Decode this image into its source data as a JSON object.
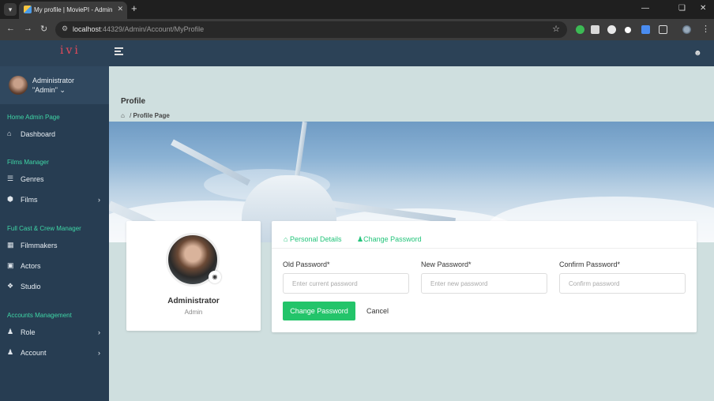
{
  "browser": {
    "tab_title": "My profile | MoviePI - Admin",
    "url_host": "localhost",
    "url_path": ":44329/Admin/Account/MyProfile",
    "extension_badge": "2"
  },
  "header": {
    "logo_text": "ivi"
  },
  "sidebar": {
    "user": {
      "name": "Administrator",
      "role": "\"Admin\""
    },
    "sections": [
      {
        "title": "Home Admin Page",
        "items": [
          {
            "label": "Dashboard",
            "icon": "home-icon"
          }
        ]
      },
      {
        "title": "Films Manager",
        "items": [
          {
            "label": "Genres",
            "icon": "list-icon"
          },
          {
            "label": "Films",
            "icon": "cube-icon",
            "has_submenu": true
          }
        ]
      },
      {
        "title": "Full Cast & Crew Manager",
        "items": [
          {
            "label": "Filmmakers",
            "icon": "film-icon"
          },
          {
            "label": "Actors",
            "icon": "id-card-icon"
          },
          {
            "label": "Studio",
            "icon": "dropbox-icon"
          }
        ]
      },
      {
        "title": "Accounts Management",
        "items": [
          {
            "label": "Role",
            "icon": "user-gear-icon",
            "has_submenu": true
          },
          {
            "label": "Account",
            "icon": "user-gear-icon",
            "has_submenu": true
          }
        ]
      }
    ]
  },
  "main": {
    "page_title": "Profile",
    "breadcrumb": {
      "current": "Profile Page"
    },
    "profile_card": {
      "name": "Administrator",
      "role": "Admin"
    },
    "tabs": [
      {
        "label": "Personal Details",
        "icon": "home-icon"
      },
      {
        "label": "Change Password",
        "icon": "user-icon"
      }
    ],
    "form": {
      "old_password": {
        "label": "Old Password*",
        "placeholder": "Enter current password"
      },
      "new_password": {
        "label": "New Password*",
        "placeholder": "Enter new password"
      },
      "confirm_password": {
        "label": "Confirm Password*",
        "placeholder": "Confirm password"
      },
      "submit_label": "Change Password",
      "cancel_label": "Cancel"
    }
  },
  "colors": {
    "sidebar_bg": "#273d52",
    "header_bg": "#2c4257",
    "section_title": "#3fd6a6",
    "accent_green": "#23c46a",
    "main_bg": "#cfdfdf"
  }
}
